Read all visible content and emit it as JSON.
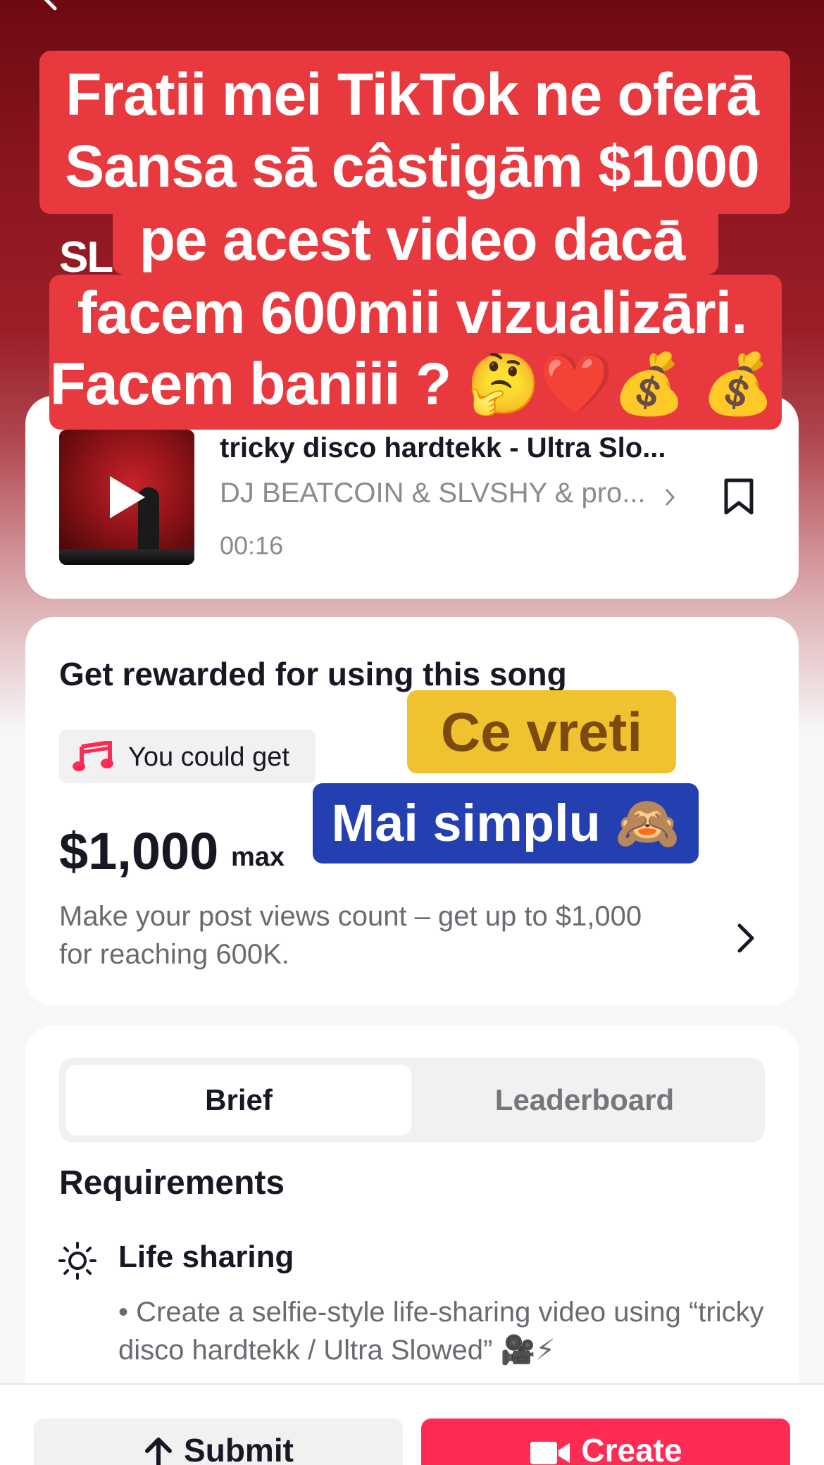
{
  "overlay": {
    "lines": [
      "Fratii mei TikTok ne oferā",
      "Sansa sā câstigām $1000",
      "pe acest video dacā",
      "facem 600mii vizualizāri.",
      "Facem baniii ? 🤔❤️💰 💰"
    ],
    "behind_text": "SL"
  },
  "song": {
    "title": "tricky disco hardtekk - Ultra Slo...",
    "artist": "DJ BEATCOIN & SLVSHY & pro...",
    "duration": "00:16"
  },
  "reward": {
    "heading": "Get rewarded for using this song",
    "pill_label": "You could get",
    "amount": "$1,000",
    "max_label": "max",
    "description": "Make your post views count – get up to $1,000 for reaching 600K."
  },
  "stickers": {
    "yellow": "Ce vreti",
    "blue": "Mai simplu 🙈"
  },
  "tabs": {
    "brief": "Brief",
    "leaderboard": "Leaderboard"
  },
  "requirements": {
    "heading": "Requirements",
    "item_title": "Life sharing",
    "item_desc": "• Create a selfie-style life-sharing video using “tricky disco hardtekk / Ultra Slowed” 🎥⚡"
  },
  "actions": {
    "submit": "Submit",
    "create": "Create"
  },
  "colors": {
    "overlay_red": "#e8393f",
    "create_pink": "#fe2c55",
    "sticker_yellow": "#f0c230",
    "sticker_blue": "#2440b0"
  }
}
